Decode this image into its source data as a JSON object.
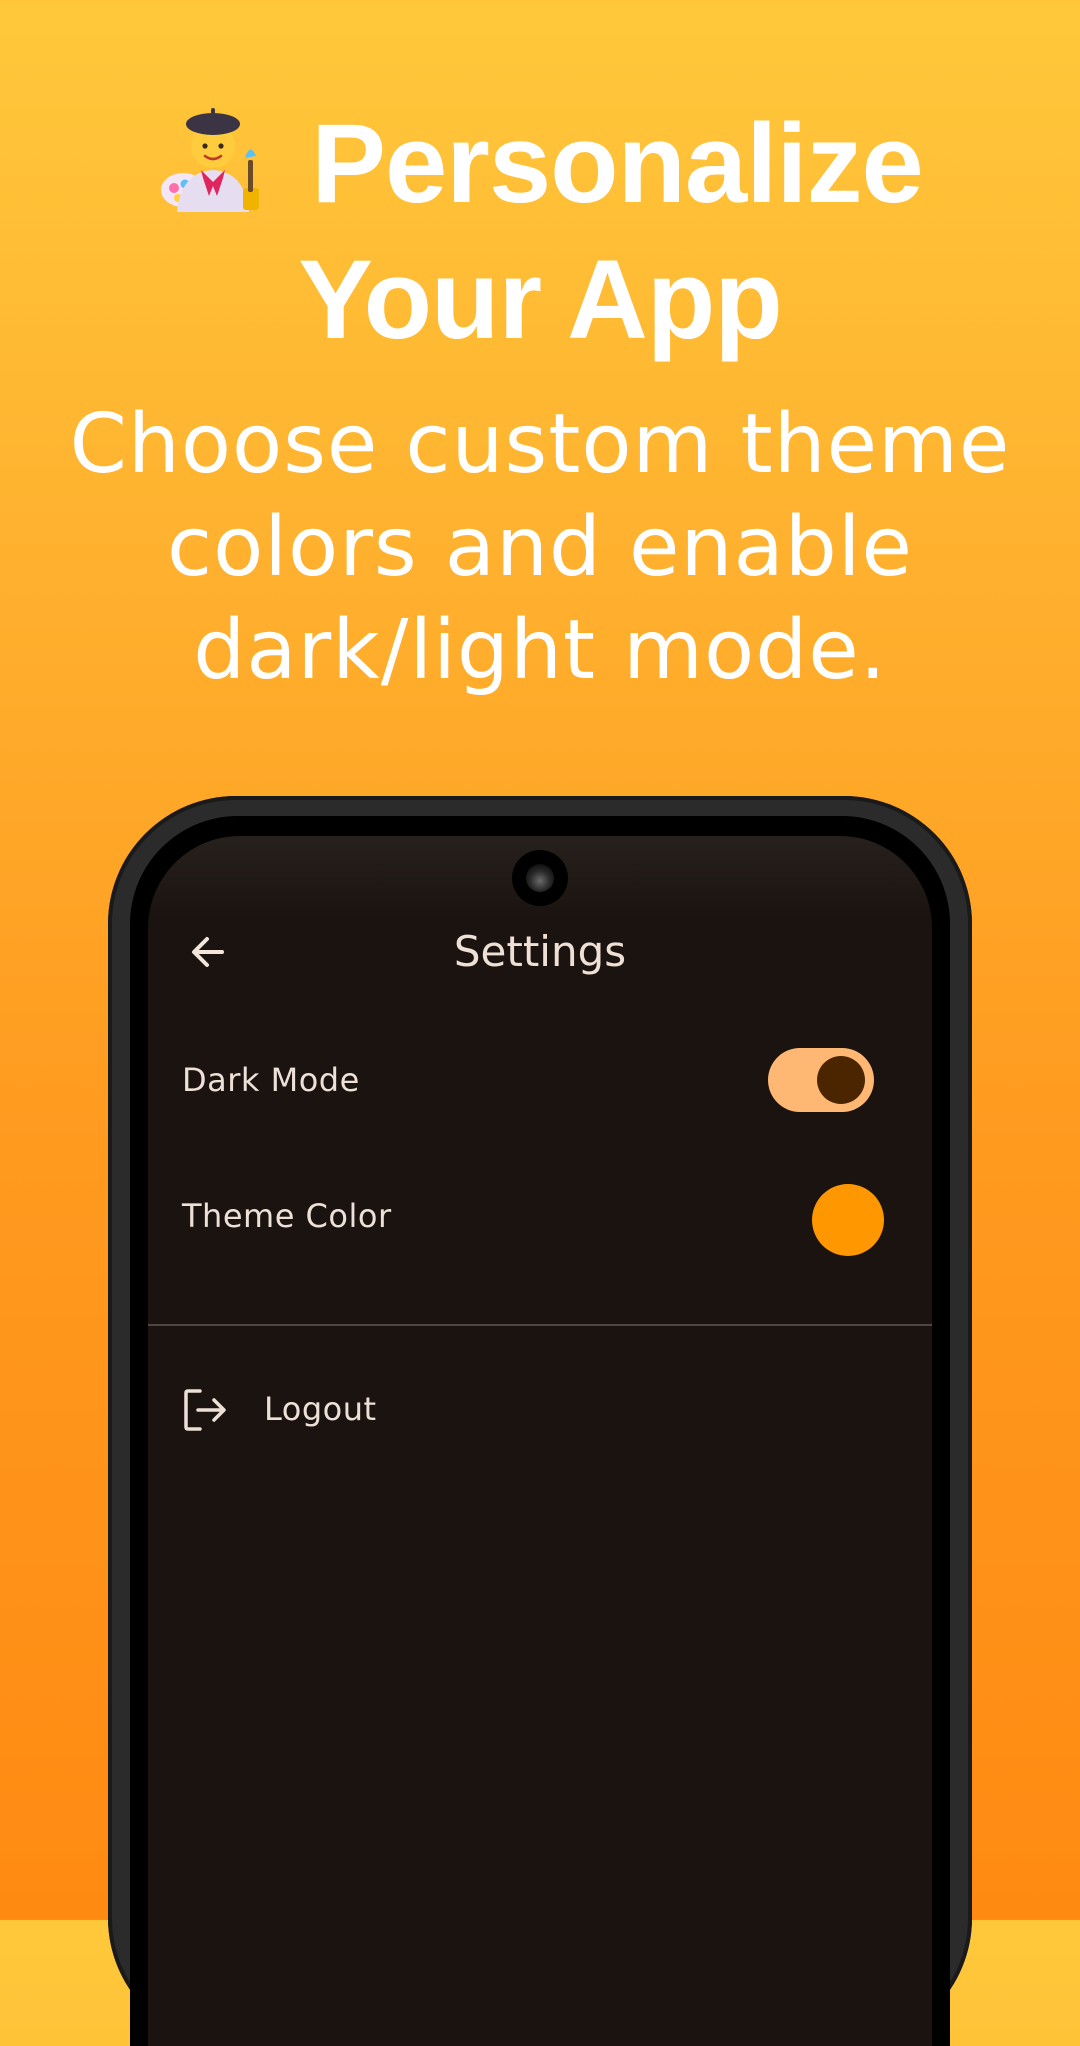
{
  "hero": {
    "emoji_icon": "artist-emoji",
    "title_line1": "Personalize",
    "title_line2": "Your App",
    "subtitle": "Choose custom theme colors and enable dark/light mode."
  },
  "settings_screen": {
    "back_icon": "arrow-left-icon",
    "title": "Settings",
    "dark_mode": {
      "label": "Dark Mode",
      "enabled": true
    },
    "theme_color": {
      "label": "Theme Color",
      "color": "#FF9800"
    },
    "logout": {
      "icon": "logout-icon",
      "label": "Logout"
    }
  },
  "colors": {
    "background_top": "#FFC83B",
    "background_bottom": "#FF8A12",
    "screen_background": "#1B1310",
    "switch_track": "#FFB873",
    "switch_thumb": "#4A2500",
    "accent": "#FF9800"
  }
}
